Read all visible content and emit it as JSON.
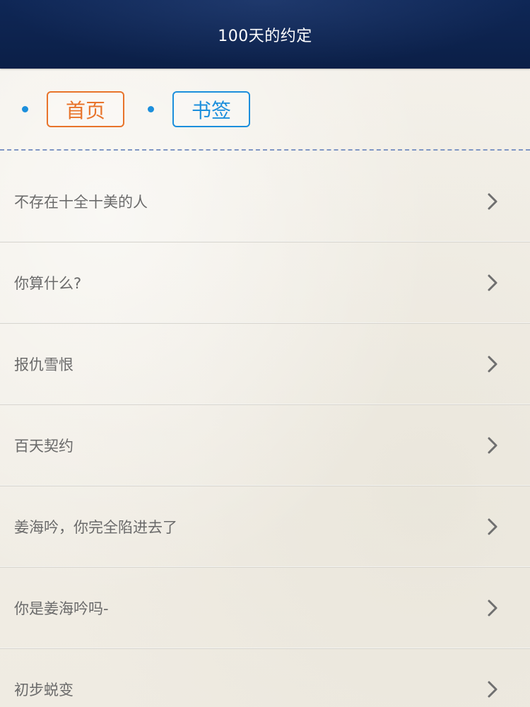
{
  "header": {
    "title": "100天的约定"
  },
  "tabs": [
    {
      "label": "首页",
      "color": "#e8742b"
    },
    {
      "label": "书签",
      "color": "#1c8fdc"
    }
  ],
  "chapters": [
    {
      "title": "不存在十全十美的人"
    },
    {
      "title": "你算什么?"
    },
    {
      "title": "报仇雪恨"
    },
    {
      "title": "百天契约"
    },
    {
      "title": "姜海吟，你完全陷进去了"
    },
    {
      "title": "你是姜海吟吗-"
    },
    {
      "title": "初步蜕变"
    }
  ],
  "icons": {
    "row_chevron": "chevron-right-icon",
    "tab_bullet": "bullet-dot-icon"
  },
  "colors": {
    "header_bg": "#0f2756",
    "divider": "#7f96c4",
    "text": "#6a6a6a"
  }
}
